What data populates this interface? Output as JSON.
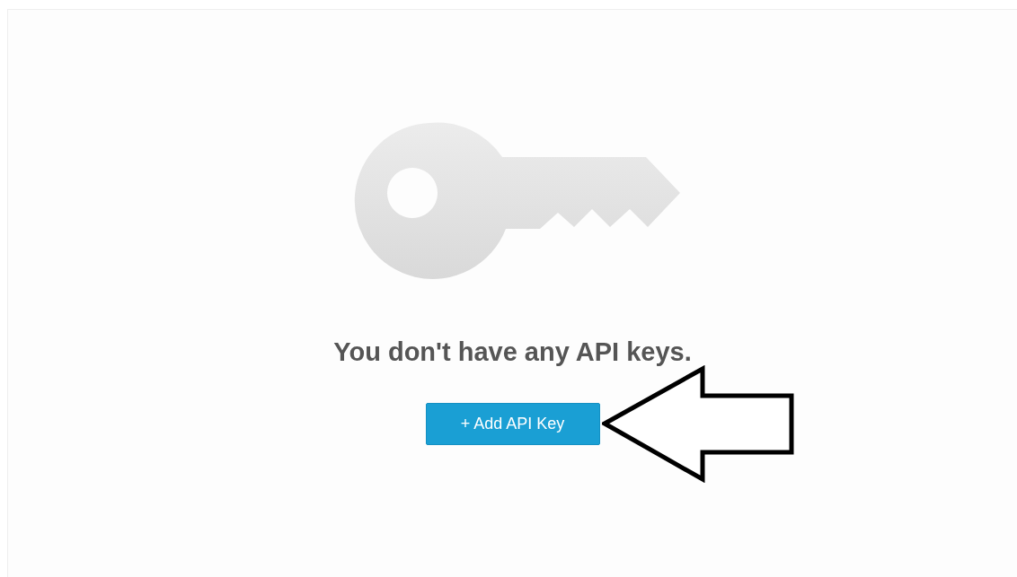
{
  "empty_state": {
    "message": "You don't have any API keys.",
    "button": {
      "label": "+ Add API Key"
    }
  }
}
